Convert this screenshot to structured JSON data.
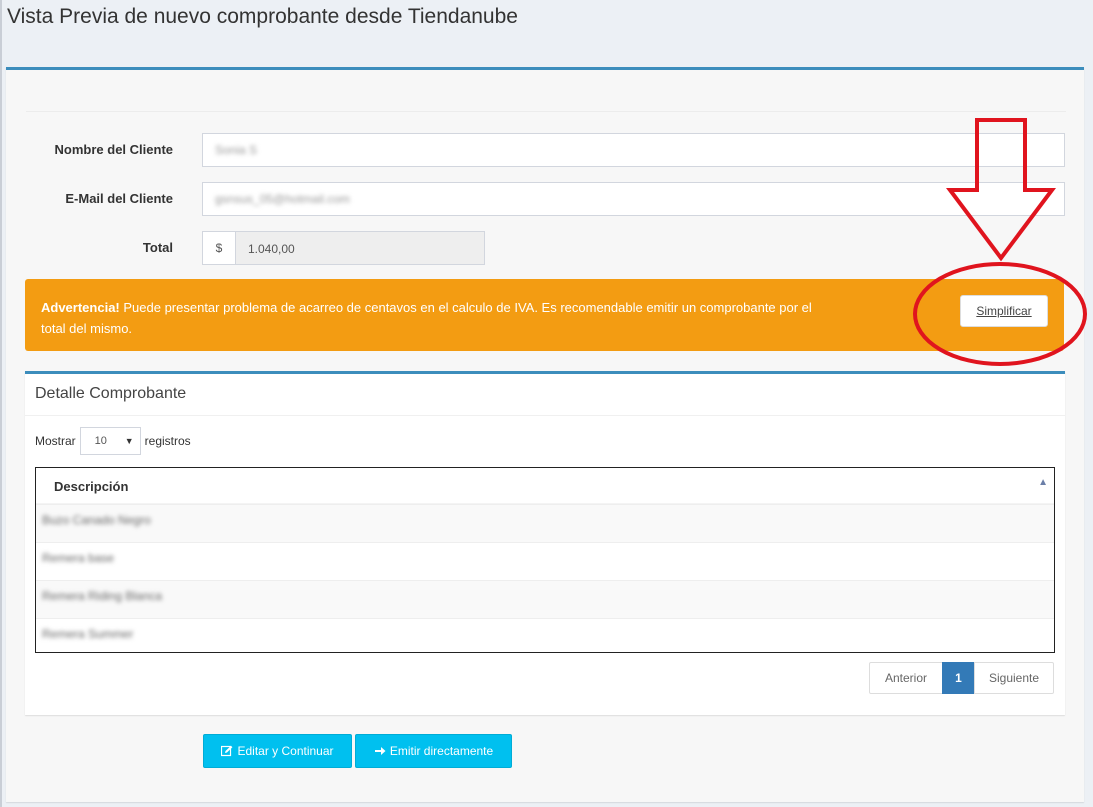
{
  "page": {
    "title": "Vista Previa de nuevo comprobante desde Tiendanube"
  },
  "form": {
    "client_name_label": "Nombre del Cliente",
    "client_name_value": "Sonia S",
    "client_email_label": "E-Mail del Cliente",
    "client_email_value": "gsnsus_05@hotmail.com",
    "total_label": "Total",
    "currency_symbol": "$",
    "total_value": "1.040,00"
  },
  "warning": {
    "title": "Advertencia!",
    "message": " Puede presentar problema de acarreo de centavos en el calculo de IVA. Es recomendable emitir un comprobante por el total del mismo.",
    "button_label": "Simplificar",
    "color": "#f39c12"
  },
  "detail": {
    "title": "Detalle Comprobante",
    "show_label": "Mostrar",
    "page_length": "10",
    "records_label": "registros",
    "column_header": "Descripción",
    "rows": [
      {
        "description": "Buzo Canado Negro"
      },
      {
        "description": "Remera base"
      },
      {
        "description": "Remera Riding Blanca"
      },
      {
        "description": "Remera Summer"
      }
    ],
    "pagination": {
      "previous": "Anterior",
      "current_page": "1",
      "next": "Siguiente"
    }
  },
  "actions": {
    "edit_label": "Editar y Continuar",
    "emit_label": "Emitir directamente"
  },
  "colors": {
    "accent": "#3c8dbc",
    "info": "#00c0ef",
    "annotation": "#e0141e"
  }
}
